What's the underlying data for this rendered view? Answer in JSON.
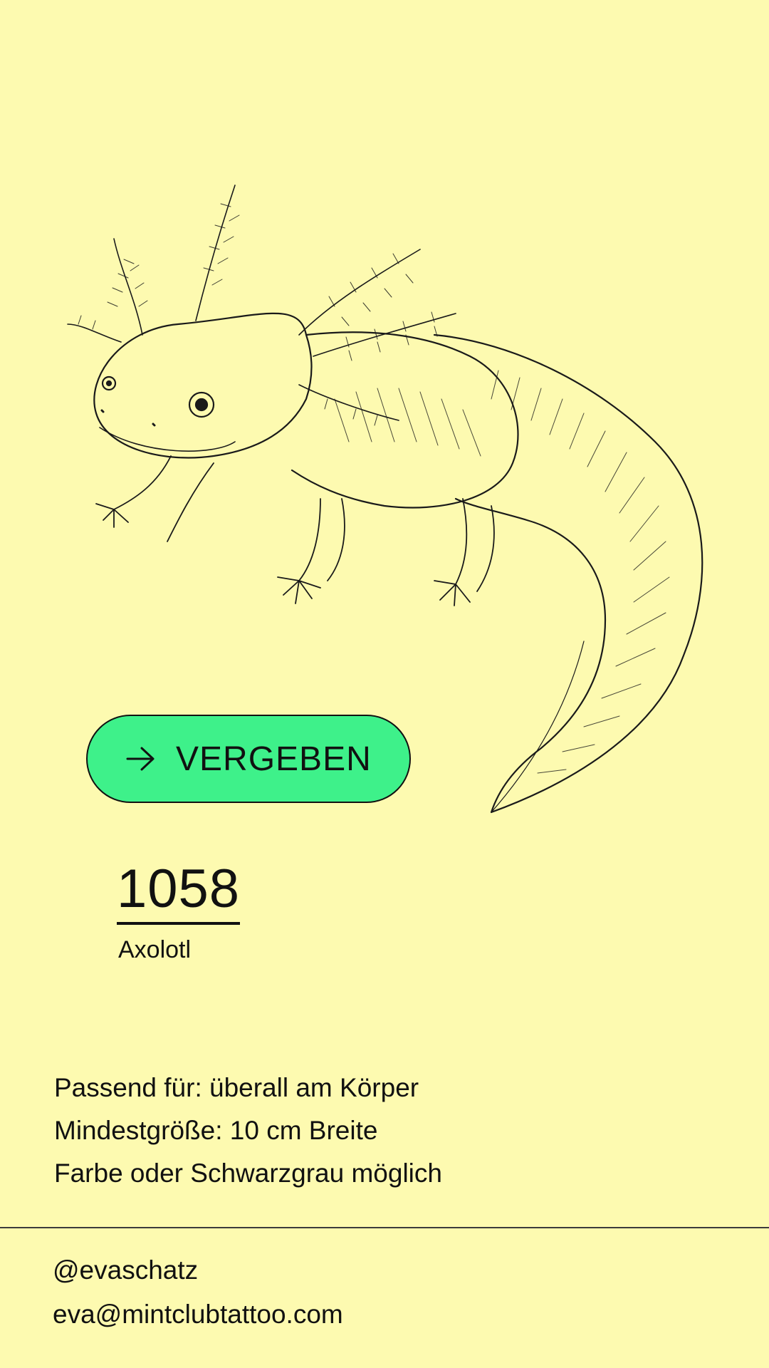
{
  "illustration": {
    "subject": "axolotl",
    "style": "line-art"
  },
  "status_button": {
    "label": "VERGEBEN",
    "icon": "arrow-right-icon",
    "color": "#3ef18a"
  },
  "design": {
    "number": "1058",
    "name": "Axolotl"
  },
  "details": [
    "Passend für: überall am Körper",
    "Mindestgröße: 10 cm Breite",
    "Farbe oder Schwarzgrau möglich"
  ],
  "contact": {
    "handle": "@evaschatz",
    "email": "eva@mintclubtattoo.com"
  },
  "colors": {
    "background": "#fdfab0",
    "accent": "#3ef18a",
    "text": "#111111"
  }
}
